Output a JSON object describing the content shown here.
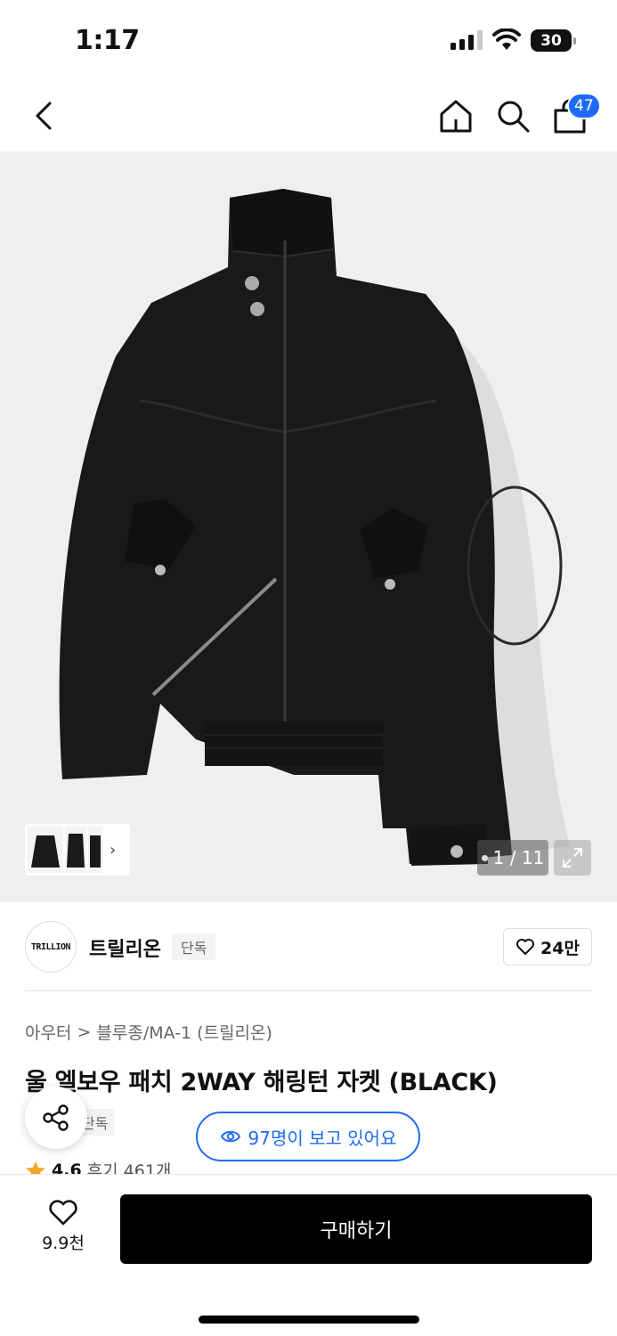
{
  "status_bar": {
    "time": "1:17",
    "battery": "30"
  },
  "nav": {
    "back_icon": "chevron-left-icon",
    "home_icon": "home-icon",
    "search_icon": "search-icon",
    "cart_icon": "shopping-bag-icon",
    "cart_count": "47"
  },
  "gallery": {
    "page_indicator": "1 / 11",
    "expand_icon": "expand-icon"
  },
  "brand": {
    "logo_text": "TRILLION",
    "name": "트릴리온",
    "tag": "단독",
    "like_count": "24만"
  },
  "breadcrumb": {
    "level1": "아우터",
    "separator": ">",
    "level2": "블루종/MA-1 (트릴리온)"
  },
  "product": {
    "title": "울 엘보우 패치 2WAY 해링턴 자켓 (BLACK)",
    "exclusive_tag": "단독",
    "rating": "4.6",
    "reviews": "후기 461개"
  },
  "viewers": {
    "text": "97명이 보고 있어요"
  },
  "bottom": {
    "wish_count": "9.9천",
    "buy_label": "구매하기"
  },
  "colors": {
    "accent": "#1f6bf5",
    "buy_button": "#000000",
    "rating_star": "#f5a623"
  }
}
